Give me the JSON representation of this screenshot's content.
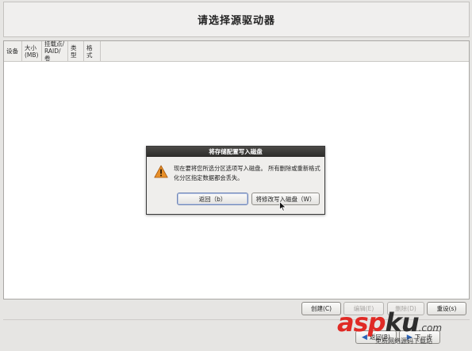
{
  "header": {
    "title": "请选择源驱动器"
  },
  "table": {
    "columns": [
      {
        "label": "设备"
      },
      {
        "label": "大小\n(MB)"
      },
      {
        "label": "挂载点/\nRAID/卷"
      },
      {
        "label": "类型"
      },
      {
        "label": "格式"
      }
    ]
  },
  "actions": {
    "create": "创建(C)",
    "edit": "编辑(E)",
    "delete": "删除(D)",
    "reset": "重设(s)"
  },
  "nav": {
    "back": "返回(B)",
    "next": "下一步"
  },
  "dialog": {
    "title": "将存储配置写入磁盘",
    "message": "现在要将您所选分区选项写入磁盘。 所有删除或重新格式化分区指定数据都会丢失。",
    "back_button": "返回（b）",
    "write_button": "将修改写入磁盘（W）",
    "icon": "warning-icon"
  },
  "watermark": {
    "logo_red": "asp",
    "logo_dark": "ku",
    "logo_suffix": ".com",
    "subtitle": "免费网络源码下载站"
  },
  "colors": {
    "background": "#e6e5e3",
    "dialog_titlebar": "#2c2b29",
    "warning": "#e8902a",
    "watermark_red": "#e02a25"
  }
}
